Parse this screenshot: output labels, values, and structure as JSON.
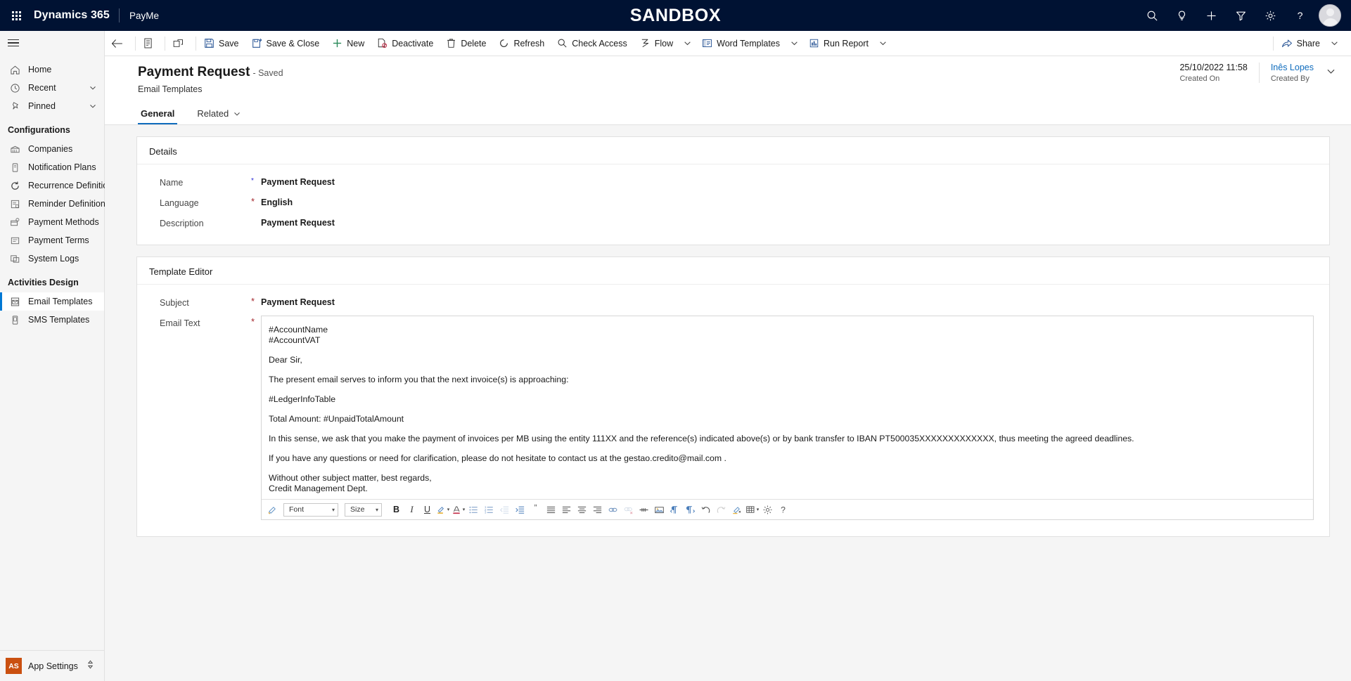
{
  "appbar": {
    "waffle_label": "app-launcher",
    "brand": "Dynamics 365",
    "app_name": "PayMe",
    "environment_banner": "SANDBOX",
    "icons": [
      {
        "name": "search-icon",
        "title": "Search"
      },
      {
        "name": "lightbulb-icon",
        "title": "Insights"
      },
      {
        "name": "plus-icon",
        "title": "Quick create"
      },
      {
        "name": "filter-icon",
        "title": "Filter"
      },
      {
        "name": "gear-icon",
        "title": "Settings"
      },
      {
        "name": "help-icon",
        "title": "Help"
      }
    ],
    "avatar_label": "user-avatar"
  },
  "sidebar": {
    "hamburger_label": "Expand navigation",
    "top_items": [
      {
        "label": "Home",
        "icon": "home-icon",
        "chevron": false
      },
      {
        "label": "Recent",
        "icon": "clock-icon",
        "chevron": true
      },
      {
        "label": "Pinned",
        "icon": "pin-icon",
        "chevron": true
      }
    ],
    "groups": [
      {
        "title": "Configurations",
        "items": [
          {
            "label": "Companies",
            "icon": "building-icon"
          },
          {
            "label": "Notification Plans",
            "icon": "notification-icon"
          },
          {
            "label": "Recurrence Definitions",
            "icon": "recurrence-icon"
          },
          {
            "label": "Reminder Definitions",
            "icon": "reminder-icon"
          },
          {
            "label": "Payment Methods",
            "icon": "payment-method-icon"
          },
          {
            "label": "Payment Terms",
            "icon": "payment-terms-icon"
          },
          {
            "label": "System Logs",
            "icon": "system-logs-icon"
          }
        ]
      },
      {
        "title": "Activities Design",
        "items": [
          {
            "label": "Email Templates",
            "icon": "email-template-icon",
            "selected": true
          },
          {
            "label": "SMS Templates",
            "icon": "sms-template-icon",
            "selected": false
          }
        ]
      }
    ],
    "app_settings": {
      "initials": "AS",
      "label": "App Settings"
    }
  },
  "commandbar": {
    "back_label": "Back",
    "form_icon_label": "Form selector",
    "popout_label": "Open in new window",
    "buttons": [
      {
        "label": "Save",
        "icon": "save-icon"
      },
      {
        "label": "Save & Close",
        "icon": "save-close-icon"
      },
      {
        "label": "New",
        "icon": "plus-icon"
      },
      {
        "label": "Deactivate",
        "icon": "deactivate-icon"
      },
      {
        "label": "Delete",
        "icon": "trash-icon"
      },
      {
        "label": "Refresh",
        "icon": "refresh-icon"
      },
      {
        "label": "Check Access",
        "icon": "check-access-icon"
      },
      {
        "label": "Flow",
        "icon": "flow-icon",
        "chevron": true
      },
      {
        "label": "Word Templates",
        "icon": "word-template-icon",
        "chevron": true
      },
      {
        "label": "Run Report",
        "icon": "report-icon",
        "chevron": true
      }
    ],
    "share": {
      "label": "Share",
      "icon": "share-icon",
      "chevron": true
    }
  },
  "form_header": {
    "title": "Payment Request",
    "status": "- Saved",
    "entity": "Email Templates",
    "created_on": {
      "value": "25/10/2022 11:58",
      "label": "Created On"
    },
    "created_by": {
      "value": "Inês Lopes",
      "label": "Created By"
    }
  },
  "tabs": [
    {
      "label": "General",
      "active": true,
      "chevron": false
    },
    {
      "label": "Related",
      "active": false,
      "chevron": true
    }
  ],
  "details_section": {
    "title": "Details",
    "fields": [
      {
        "label": "Name",
        "value": "Payment Request",
        "required": true,
        "required_style": "blue"
      },
      {
        "label": "Language",
        "value": "English",
        "required": true,
        "required_style": "red"
      },
      {
        "label": "Description",
        "value": "Payment Request",
        "required": false
      }
    ]
  },
  "template_editor": {
    "title": "Template Editor",
    "subject": {
      "label": "Subject",
      "value": "Payment Request",
      "required": true
    },
    "email_text": {
      "label": "Email Text",
      "required": true,
      "paragraphs": [
        "#AccountName\n#AccountVAT",
        "Dear Sir,",
        "The present email serves to inform you that the next invoice(s) is approaching:",
        "#LedgerInfoTable",
        "Total Amount: #UnpaidTotalAmount",
        "In this sense, we ask that you make the payment of invoices per MB using the entity 111XX and the reference(s) indicated above(s) or by bank transfer to IBAN PT500035XXXXXXXXXXXXX, thus meeting the agreed deadlines.",
        "If you have any questions or need for clarification, please do not hesitate to contact us at the gestao.credito@mail.com .",
        "Without other subject matter, best regards,\nCredit Management Dept."
      ]
    },
    "toolbar": {
      "font_select": "Font",
      "size_select": "Size",
      "bold": "B",
      "italic": "I",
      "underline": "U",
      "buttons": [
        {
          "name": "format-painter-icon",
          "title": "Format painter"
        },
        {
          "name": "highlight-color-icon",
          "title": "Text highlight color"
        },
        {
          "name": "font-color-icon",
          "title": "Font color"
        },
        {
          "name": "bulleted-list-icon",
          "title": "Bulleted list"
        },
        {
          "name": "numbered-list-icon",
          "title": "Numbered list"
        },
        {
          "name": "decrease-indent-icon",
          "title": "Decrease indent"
        },
        {
          "name": "increase-indent-icon",
          "title": "Increase indent"
        },
        {
          "name": "blockquote-icon",
          "title": "Block quote"
        },
        {
          "name": "align-justify-icon",
          "title": "Justify"
        },
        {
          "name": "align-left-icon",
          "title": "Align left"
        },
        {
          "name": "align-center-icon",
          "title": "Align center"
        },
        {
          "name": "align-right-icon",
          "title": "Align right"
        },
        {
          "name": "insert-link-icon",
          "title": "Insert link"
        },
        {
          "name": "remove-link-icon",
          "title": "Remove link"
        },
        {
          "name": "horizontal-rule-icon",
          "title": "Horizontal line"
        },
        {
          "name": "insert-image-icon",
          "title": "Insert image"
        },
        {
          "name": "rtl-direction-icon",
          "title": "Right to left"
        },
        {
          "name": "ltr-direction-icon",
          "title": "Left to right"
        },
        {
          "name": "undo-icon",
          "title": "Undo"
        },
        {
          "name": "redo-icon",
          "title": "Redo"
        },
        {
          "name": "clear-format-icon",
          "title": "Clear formatting"
        },
        {
          "name": "insert-table-icon",
          "title": "Insert table"
        },
        {
          "name": "editor-settings-icon",
          "title": "Settings"
        },
        {
          "name": "editor-help-icon",
          "title": "Help"
        }
      ]
    }
  },
  "colors": {
    "appbar_bg": "#001233",
    "accent": "#0f6cbd",
    "required": "#a4262c",
    "app_tile": "#ca5010",
    "canvas": "#f5f5f5"
  }
}
